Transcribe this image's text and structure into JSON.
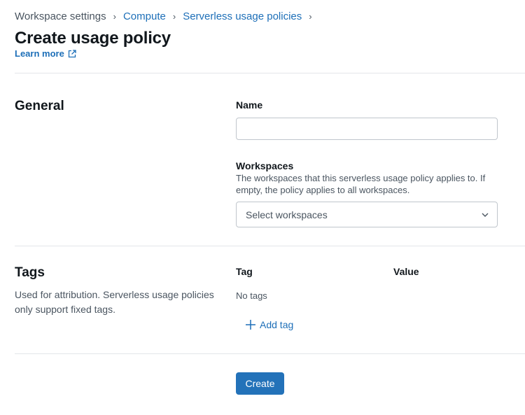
{
  "breadcrumb": {
    "items": [
      {
        "label": "Workspace settings",
        "link": false
      },
      {
        "label": "Compute",
        "link": true
      },
      {
        "label": "Serverless usage policies",
        "link": true
      }
    ],
    "separator": "›"
  },
  "header": {
    "title": "Create usage policy",
    "learn_more": "Learn more"
  },
  "general": {
    "title": "General",
    "name_label": "Name",
    "name_value": "",
    "workspaces_label": "Workspaces",
    "workspaces_description": "The workspaces that this serverless usage policy applies to. If empty, the policy applies to all workspaces.",
    "workspaces_placeholder": "Select workspaces"
  },
  "tags": {
    "title": "Tags",
    "description": "Used for attribution. Serverless usage policies only support fixed tags.",
    "column_tag": "Tag",
    "column_value": "Value",
    "empty_text": "No tags",
    "add_label": "Add tag"
  },
  "footer": {
    "create_label": "Create"
  },
  "icons": {
    "breadcrumb_separator": "chevron-right-icon",
    "learn_more": "external-link-icon",
    "select": "chevron-down-icon",
    "add_tag": "plus-icon"
  },
  "colors": {
    "link": "#1d6fb8",
    "primary_button": "#2372b9",
    "divider": "#e3e6e9",
    "border": "#c0c6cc"
  }
}
